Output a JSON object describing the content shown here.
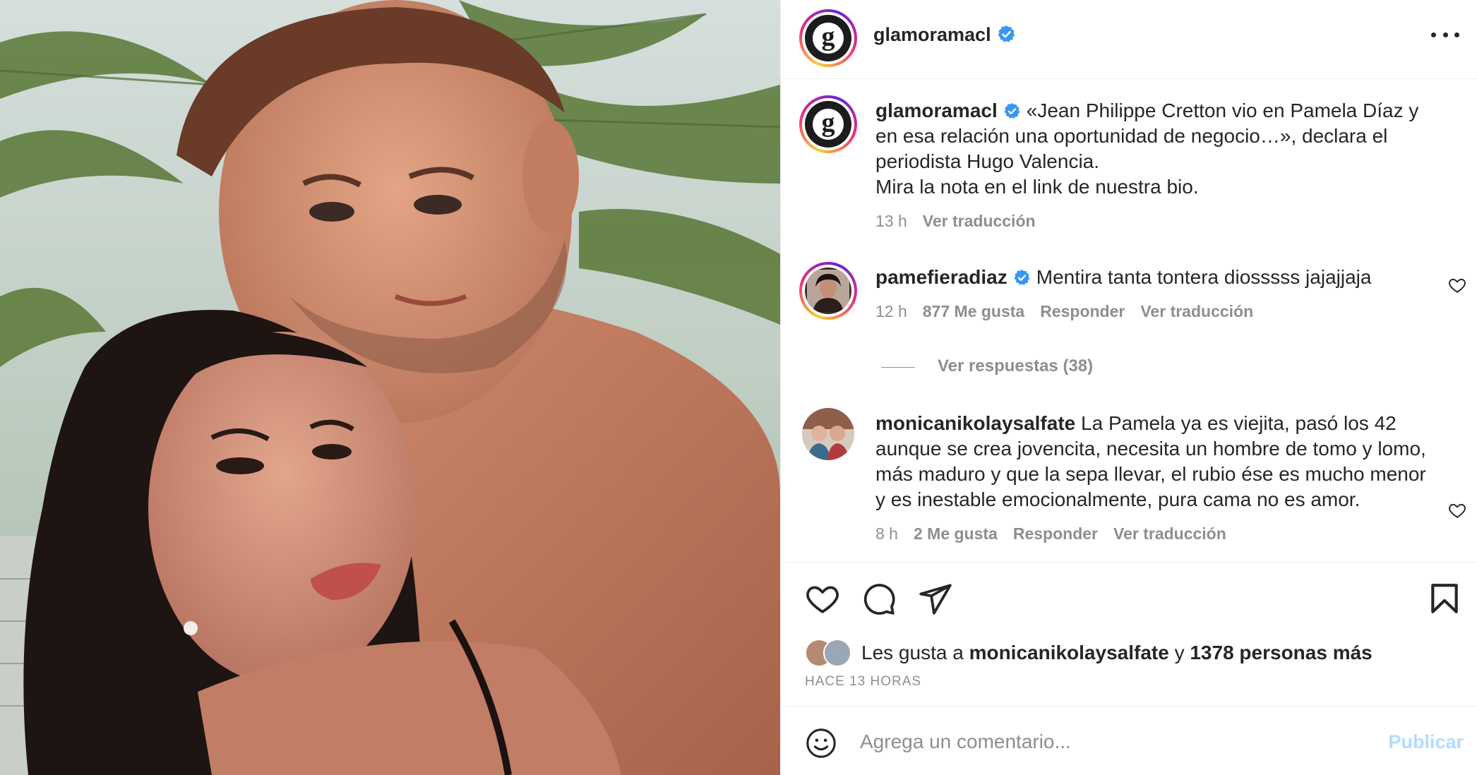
{
  "post": {
    "account": {
      "username": "glamoramacl",
      "verified": true,
      "avatar_letter": "g"
    },
    "caption": {
      "username": "glamoramacl",
      "text": "«Jean Philippe Cretton vio en Pamela Díaz y en esa relación una oportunidad de negocio…», declara el periodista Hugo Valencia.",
      "text_line2": "Mira la nota en el link de nuestra bio.",
      "time": "13 h",
      "translate": "Ver traducción"
    },
    "comments": [
      {
        "username": "pamefieradiaz",
        "verified": true,
        "text": "Mentira tanta tontera diosssss jajajjaja",
        "time": "12 h",
        "likes": "877 Me gusta",
        "reply": "Responder",
        "translate": "Ver traducción",
        "replies": "Ver respuestas (38)"
      },
      {
        "username": "monicanikolaysalfate",
        "verified": false,
        "text": "La Pamela ya es viejita, pasó los 42 aunque se crea jovencita, necesita un hombre de tomo y lomo, más maduro y que la sepa llevar, el rubio ése es mucho menor y es inestable emocionalmente, pura cama no es amor.",
        "time": "8 h",
        "likes": "2 Me gusta",
        "reply": "Responder",
        "translate": "Ver traducción"
      }
    ],
    "likes": {
      "prefix": "Les gusta a",
      "user": "monicanikolaysalfate",
      "joiner": "y",
      "others": "1378 personas más"
    },
    "timestamp": "HACE 13 HORAS",
    "add_comment": {
      "placeholder": "Agrega un comentario...",
      "publish": "Publicar"
    }
  },
  "colors": {
    "accent": "#0095f6",
    "verified": "#3897f0",
    "muted": "#8e8e8e",
    "publish_disabled": "#b3dbff"
  },
  "icons": [
    "heart-icon",
    "comment-icon",
    "share-icon",
    "bookmark-icon",
    "emoji-icon",
    "verified-icon",
    "more-icon"
  ]
}
